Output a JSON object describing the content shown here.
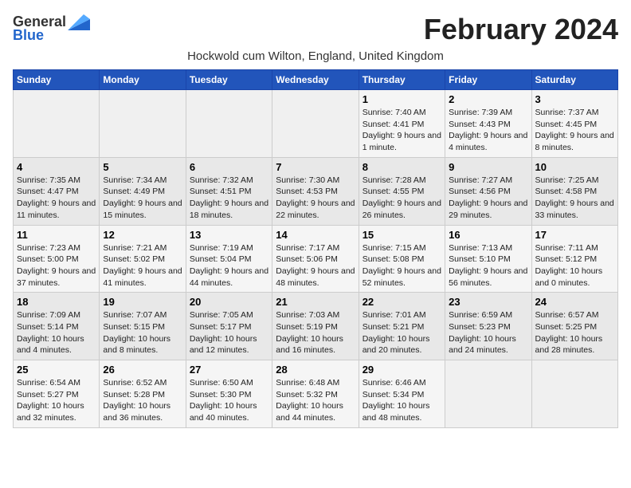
{
  "logo": {
    "text_general": "General",
    "text_blue": "Blue"
  },
  "title": "February 2024",
  "subtitle": "Hockwold cum Wilton, England, United Kingdom",
  "header": {
    "days": [
      "Sunday",
      "Monday",
      "Tuesday",
      "Wednesday",
      "Thursday",
      "Friday",
      "Saturday"
    ]
  },
  "weeks": [
    {
      "cells": [
        {
          "day": "",
          "info": ""
        },
        {
          "day": "",
          "info": ""
        },
        {
          "day": "",
          "info": ""
        },
        {
          "day": "",
          "info": ""
        },
        {
          "day": "1",
          "info": "Sunrise: 7:40 AM\nSunset: 4:41 PM\nDaylight: 9 hours and 1 minute."
        },
        {
          "day": "2",
          "info": "Sunrise: 7:39 AM\nSunset: 4:43 PM\nDaylight: 9 hours and 4 minutes."
        },
        {
          "day": "3",
          "info": "Sunrise: 7:37 AM\nSunset: 4:45 PM\nDaylight: 9 hours and 8 minutes."
        }
      ]
    },
    {
      "cells": [
        {
          "day": "4",
          "info": "Sunrise: 7:35 AM\nSunset: 4:47 PM\nDaylight: 9 hours and 11 minutes."
        },
        {
          "day": "5",
          "info": "Sunrise: 7:34 AM\nSunset: 4:49 PM\nDaylight: 9 hours and 15 minutes."
        },
        {
          "day": "6",
          "info": "Sunrise: 7:32 AM\nSunset: 4:51 PM\nDaylight: 9 hours and 18 minutes."
        },
        {
          "day": "7",
          "info": "Sunrise: 7:30 AM\nSunset: 4:53 PM\nDaylight: 9 hours and 22 minutes."
        },
        {
          "day": "8",
          "info": "Sunrise: 7:28 AM\nSunset: 4:55 PM\nDaylight: 9 hours and 26 minutes."
        },
        {
          "day": "9",
          "info": "Sunrise: 7:27 AM\nSunset: 4:56 PM\nDaylight: 9 hours and 29 minutes."
        },
        {
          "day": "10",
          "info": "Sunrise: 7:25 AM\nSunset: 4:58 PM\nDaylight: 9 hours and 33 minutes."
        }
      ]
    },
    {
      "cells": [
        {
          "day": "11",
          "info": "Sunrise: 7:23 AM\nSunset: 5:00 PM\nDaylight: 9 hours and 37 minutes."
        },
        {
          "day": "12",
          "info": "Sunrise: 7:21 AM\nSunset: 5:02 PM\nDaylight: 9 hours and 41 minutes."
        },
        {
          "day": "13",
          "info": "Sunrise: 7:19 AM\nSunset: 5:04 PM\nDaylight: 9 hours and 44 minutes."
        },
        {
          "day": "14",
          "info": "Sunrise: 7:17 AM\nSunset: 5:06 PM\nDaylight: 9 hours and 48 minutes."
        },
        {
          "day": "15",
          "info": "Sunrise: 7:15 AM\nSunset: 5:08 PM\nDaylight: 9 hours and 52 minutes."
        },
        {
          "day": "16",
          "info": "Sunrise: 7:13 AM\nSunset: 5:10 PM\nDaylight: 9 hours and 56 minutes."
        },
        {
          "day": "17",
          "info": "Sunrise: 7:11 AM\nSunset: 5:12 PM\nDaylight: 10 hours and 0 minutes."
        }
      ]
    },
    {
      "cells": [
        {
          "day": "18",
          "info": "Sunrise: 7:09 AM\nSunset: 5:14 PM\nDaylight: 10 hours and 4 minutes."
        },
        {
          "day": "19",
          "info": "Sunrise: 7:07 AM\nSunset: 5:15 PM\nDaylight: 10 hours and 8 minutes."
        },
        {
          "day": "20",
          "info": "Sunrise: 7:05 AM\nSunset: 5:17 PM\nDaylight: 10 hours and 12 minutes."
        },
        {
          "day": "21",
          "info": "Sunrise: 7:03 AM\nSunset: 5:19 PM\nDaylight: 10 hours and 16 minutes."
        },
        {
          "day": "22",
          "info": "Sunrise: 7:01 AM\nSunset: 5:21 PM\nDaylight: 10 hours and 20 minutes."
        },
        {
          "day": "23",
          "info": "Sunrise: 6:59 AM\nSunset: 5:23 PM\nDaylight: 10 hours and 24 minutes."
        },
        {
          "day": "24",
          "info": "Sunrise: 6:57 AM\nSunset: 5:25 PM\nDaylight: 10 hours and 28 minutes."
        }
      ]
    },
    {
      "cells": [
        {
          "day": "25",
          "info": "Sunrise: 6:54 AM\nSunset: 5:27 PM\nDaylight: 10 hours and 32 minutes."
        },
        {
          "day": "26",
          "info": "Sunrise: 6:52 AM\nSunset: 5:28 PM\nDaylight: 10 hours and 36 minutes."
        },
        {
          "day": "27",
          "info": "Sunrise: 6:50 AM\nSunset: 5:30 PM\nDaylight: 10 hours and 40 minutes."
        },
        {
          "day": "28",
          "info": "Sunrise: 6:48 AM\nSunset: 5:32 PM\nDaylight: 10 hours and 44 minutes."
        },
        {
          "day": "29",
          "info": "Sunrise: 6:46 AM\nSunset: 5:34 PM\nDaylight: 10 hours and 48 minutes."
        },
        {
          "day": "",
          "info": ""
        },
        {
          "day": "",
          "info": ""
        }
      ]
    }
  ]
}
